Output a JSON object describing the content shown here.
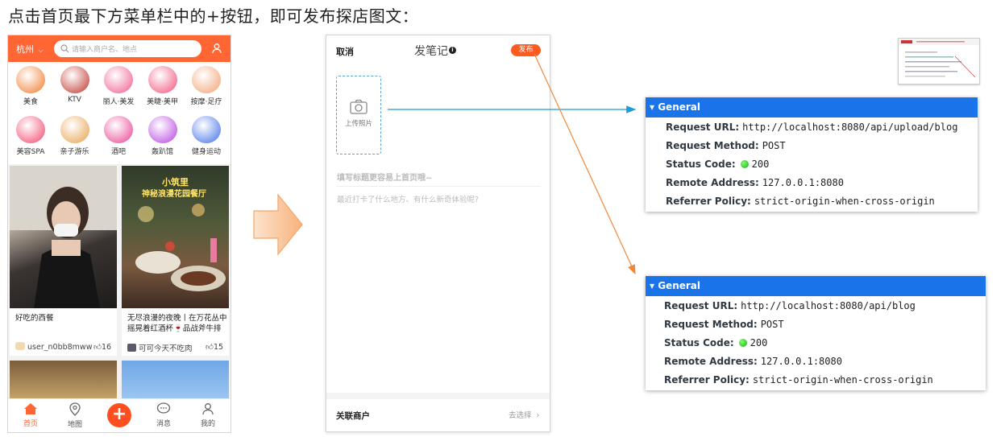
{
  "heading": "点击首页最下方菜单栏中的+按钮，即可发布探店图文：",
  "home": {
    "city": "杭州",
    "search_placeholder": "请输入商户名、地点",
    "categories": [
      {
        "label": "美食",
        "icon": "chicken-icon",
        "color": "#f07a2a"
      },
      {
        "label": "KTV",
        "icon": "microphone-icon",
        "color": "#c0322a"
      },
      {
        "label": "丽人·美发",
        "icon": "hair-icon",
        "color": "#ef5a8a"
      },
      {
        "label": "美睫·美甲",
        "icon": "nail-icon",
        "color": "#f0507a"
      },
      {
        "label": "按摩·足疗",
        "icon": "massage-icon",
        "color": "#f2a070"
      },
      {
        "label": "美容SPA",
        "icon": "face-mask-icon",
        "color": "#f2456a"
      },
      {
        "label": "亲子游乐",
        "icon": "family-icon",
        "color": "#e7a04a"
      },
      {
        "label": "酒吧",
        "icon": "cocktail-icon",
        "color": "#e94090"
      },
      {
        "label": "轰趴馆",
        "icon": "party-mask-icon",
        "color": "#b540e0"
      },
      {
        "label": "健身运动",
        "icon": "dumbbell-icon",
        "color": "#3f6fe8"
      }
    ],
    "cards": [
      {
        "title": "好吃的西餐",
        "author": "user_n0bb8mww",
        "likes": "16"
      },
      {
        "title": "无尽浪漫的夜晚丨在万花丛中摇晃着红酒杯🍷品战斧牛排",
        "author": "可可今天不吃肉",
        "likes": "15",
        "overlay1": "小筑里",
        "overlay2": "神秘浪漫花园餐厅"
      }
    ],
    "tabs": [
      {
        "label": "首页",
        "icon": "home-icon"
      },
      {
        "label": "地图",
        "icon": "map-icon"
      },
      {
        "label": "消息",
        "icon": "message-icon"
      },
      {
        "label": "我的",
        "icon": "profile-icon"
      }
    ],
    "fab": "+"
  },
  "editor": {
    "cancel": "取消",
    "title": "发笔记",
    "info_glyph": "i",
    "publish": "发布",
    "upload_label": "上传照片",
    "title_placeholder": "填写标题更容易上首页哦~",
    "body_placeholder": "最近打卡了什么地方、有什么新奇体验呢?",
    "shop_label": "关联商户",
    "shop_choose": "去选择"
  },
  "panels": [
    {
      "header": "▾ General",
      "request_url_label": "Request URL:",
      "request_url": "http://localhost:8080/api/upload/blog",
      "method_label": "Request Method:",
      "method": "POST",
      "status_label": "Status Code:",
      "status": "200",
      "remote_label": "Remote Address:",
      "remote": "127.0.0.1:8080",
      "referrer_label": "Referrer Policy:",
      "referrer": "strict-origin-when-cross-origin"
    },
    {
      "header": "▾ General",
      "request_url_label": "Request URL:",
      "request_url": "http://localhost:8080/api/blog",
      "method_label": "Request Method:",
      "method": "POST",
      "status_label": "Status Code:",
      "status": "200",
      "remote_label": "Remote Address:",
      "remote": "127.0.0.1:8080",
      "referrer_label": "Referrer Policy:",
      "referrer": "strict-origin-when-cross-origin"
    }
  ],
  "colors": {
    "brand": "#ff6633",
    "devtools_header": "#1a73e8",
    "arrow_blue": "#1e9bd7",
    "arrow_orange": "#f0883a"
  }
}
